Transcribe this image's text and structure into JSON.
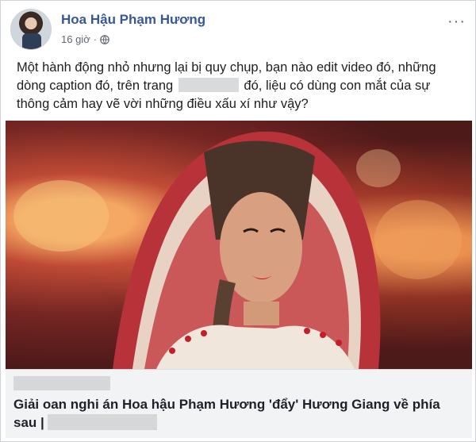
{
  "post": {
    "author_name": "Hoa Hậu Phạm Hương",
    "timestamp": "16 giờ",
    "privacy_icon": "globe-icon",
    "more_label": "···",
    "text_before": "Một hành động nhỏ nhưng lại bị quy chụp, bạn nào edit video đó, những dòng caption đó, trên trang",
    "text_after": "đó, liệu có dùng con mắt của sự thông cảm hay vẽ vời những điều xấu xí như vậy?"
  },
  "link_preview": {
    "title": "Giải oan nghi án Hoa hậu Phạm Hương 'đẩy' Hương Giang về phía sau |"
  },
  "colors": {
    "author": "#385898",
    "meta": "#616770",
    "link_bg": "#f2f3f5",
    "redaction": "#d6d7d9"
  }
}
